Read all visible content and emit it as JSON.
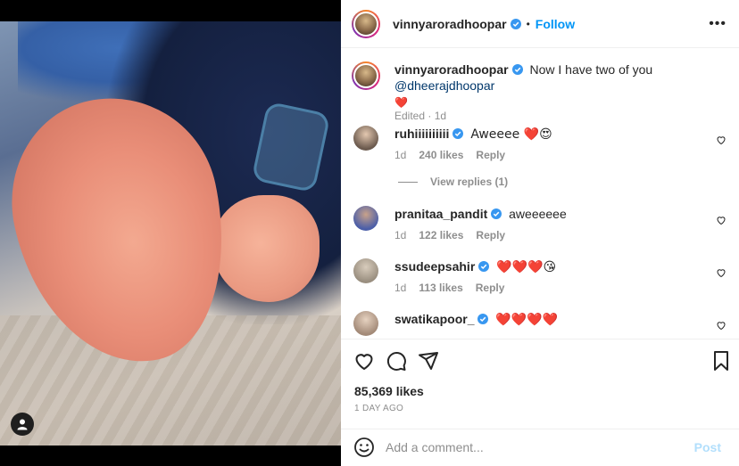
{
  "post": {
    "author": "vinnyaroradhoopar",
    "follow_label": "Follow",
    "dot": "•",
    "more_label": "•••",
    "caption_prefix": "Now I have two of you ",
    "caption_mention": "@dheerajdhoopar",
    "caption_emoji": "❤️",
    "caption_meta": "Edited · 1d",
    "likes": "85,369 likes",
    "time_ago": "1 DAY AGO"
  },
  "comments": [
    {
      "user": "ruhiiiiiiiiii",
      "verified": true,
      "text": "Aweeee ❤️😍",
      "age": "1d",
      "likes": "240 likes",
      "reply": "Reply",
      "avatar_color": "#6b5a4e"
    },
    {
      "user": "pranitaa_pandit",
      "verified": true,
      "text": "aweeeeee",
      "age": "1d",
      "likes": "122 likes",
      "reply": "Reply",
      "avatar_color": "#4b5ea8"
    },
    {
      "user": "ssudeepsahir",
      "verified": true,
      "text": "❤️❤️❤️😘",
      "age": "1d",
      "likes": "113 likes",
      "reply": "Reply",
      "avatar_color": "#9a8f80"
    },
    {
      "user": "swatikapoor_",
      "verified": true,
      "text": "❤️❤️❤️❤️",
      "age": "",
      "likes": "",
      "reply": "",
      "avatar_color": "#a38a78"
    }
  ],
  "view_replies": "View replies (1)",
  "add_comment": {
    "placeholder": "Add a comment...",
    "post_label": "Post"
  },
  "colors": {
    "accent": "#0095f6",
    "post_disabled": "#b2dffc",
    "verified": "#3897f0"
  },
  "icons": [
    "heart-icon",
    "comment-icon",
    "share-icon",
    "bookmark-icon",
    "smile-icon",
    "more-icon",
    "verified-icon",
    "user-tag-icon"
  ]
}
